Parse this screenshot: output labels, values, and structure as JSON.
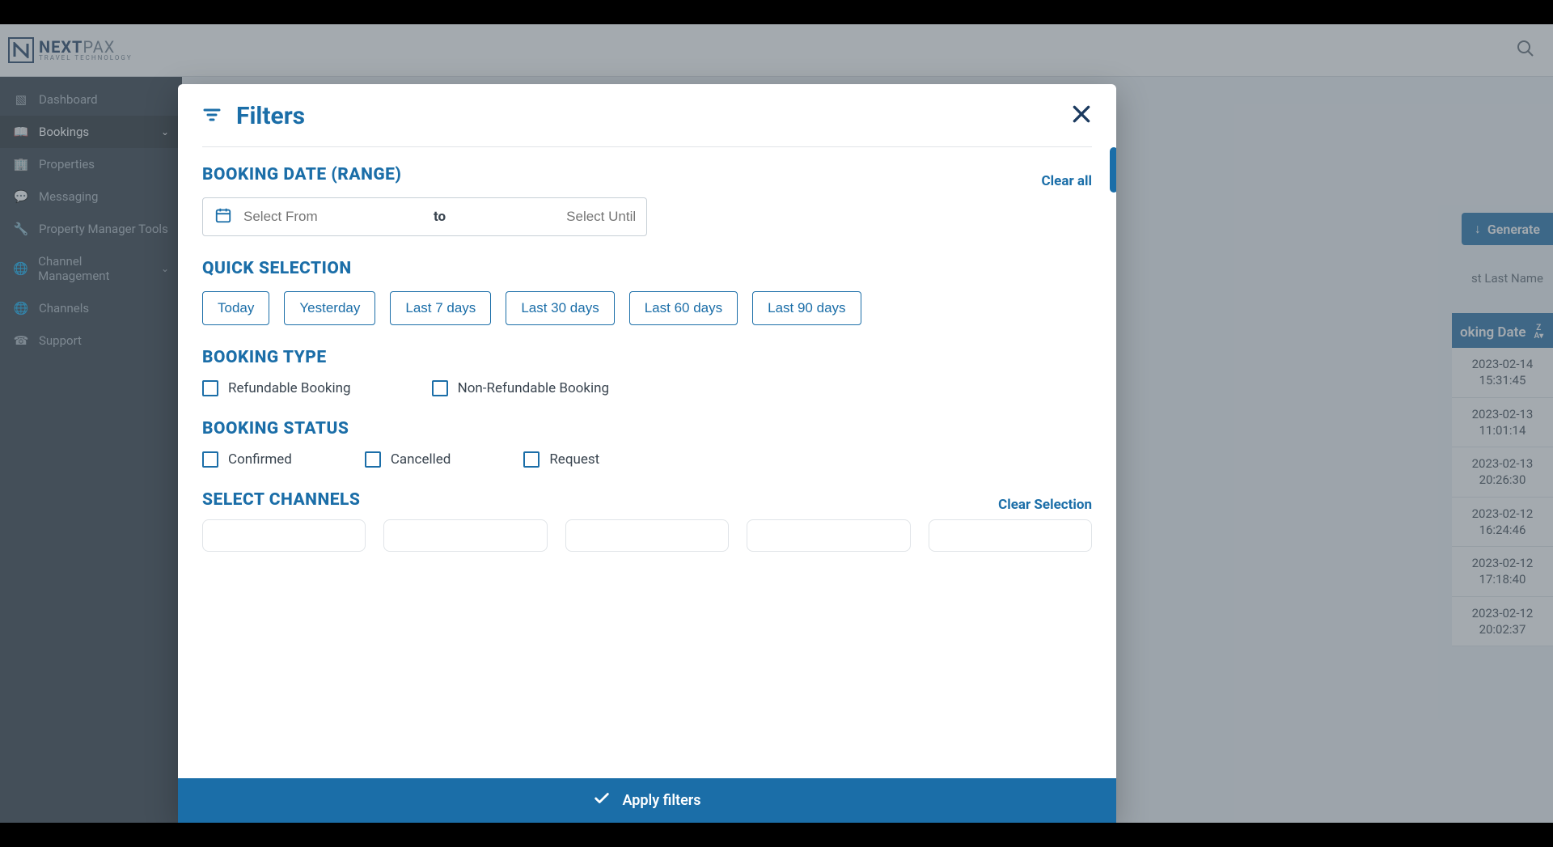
{
  "brand": {
    "main1": "NEXT",
    "main2": "PAX",
    "sub": "TRAVEL TECHNOLOGY"
  },
  "sidebar": {
    "items": [
      {
        "label": "Dashboard"
      },
      {
        "label": "Bookings"
      },
      {
        "label": "Properties"
      },
      {
        "label": "Messaging"
      },
      {
        "label": "Property Manager Tools"
      },
      {
        "label": "Channel Management"
      },
      {
        "label": "Channels"
      },
      {
        "label": "Support"
      }
    ]
  },
  "toolbar": {
    "generate": "Generate",
    "guest_filter_placeholder": "st Last Name",
    "booking_date_col": "oking Date"
  },
  "rows": [
    "2023-02-14 15:31:45",
    "2023-02-13 11:01:14",
    "2023-02-13 20:26:30",
    "2023-02-12 16:24:46",
    "2023-02-12 17:18:40",
    "2023-02-12 20:02:37"
  ],
  "modal": {
    "title": "Filters",
    "clear_all": "Clear all",
    "sections": {
      "booking_date": "BOOKING DATE (RANGE)",
      "quick": "QUICK SELECTION",
      "type": "BOOKING TYPE",
      "status": "BOOKING STATUS",
      "channels": "SELECT CHANNELS"
    },
    "date": {
      "from_placeholder": "Select From",
      "to_label": "to",
      "until_placeholder": "Select Until"
    },
    "quick": [
      "Today",
      "Yesterday",
      "Last 7 days",
      "Last 30 days",
      "Last 60 days",
      "Last 90 days"
    ],
    "type": [
      "Refundable Booking",
      "Non-Refundable Booking"
    ],
    "status": [
      "Confirmed",
      "Cancelled",
      "Request"
    ],
    "clear_selection": "Clear Selection",
    "apply": "Apply filters"
  }
}
